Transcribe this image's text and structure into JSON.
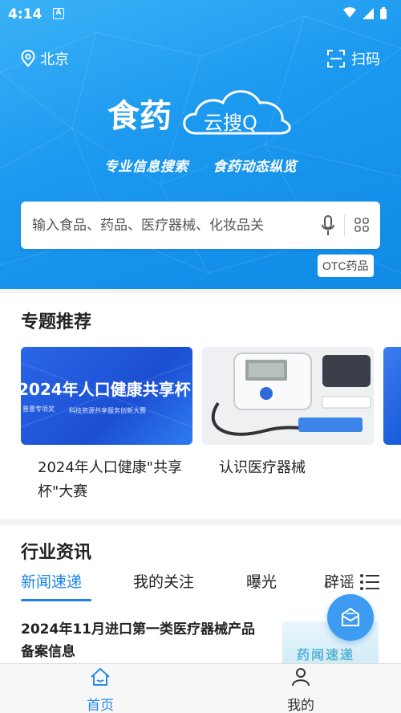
{
  "status_bar": {
    "time": "4:14",
    "a_icon": "A"
  },
  "header": {
    "location": "北京",
    "scan_label": "扫码",
    "logo": "食药云搜Q",
    "slogan_left": "专业信息搜索",
    "slogan_right": "食药动态纵览"
  },
  "search": {
    "placeholder": "输入食品、药品、医疗器械、化妆品关",
    "otc_label": "OTC药品"
  },
  "topics": {
    "title": "专题推荐",
    "cards": [
      {
        "image_text": "2024年人口健康共享杯",
        "image_sub_left": "普惠专项奖",
        "image_sub": "科技资源共享服务创新大赛",
        "caption": "2024年人口健康\"共享杯\"大赛"
      },
      {
        "image_text": "",
        "caption": "认识医疗器械"
      }
    ]
  },
  "news": {
    "title": "行业资讯",
    "tabs": [
      "新闻速递",
      "我的关注",
      "曝光",
      "辟谣"
    ],
    "active_tab": "新闻速递",
    "article_title": "2024年11月进口第一类医疗器械产品备案信息",
    "thumb_text": "药闻速递"
  },
  "bottom_nav": {
    "items": [
      {
        "label": "首页",
        "icon": "home-icon",
        "active": true
      },
      {
        "label": "我的",
        "icon": "user-icon",
        "active": false
      }
    ]
  },
  "colors": {
    "brand_blue": "#1a84e5",
    "hero_blue": "#1b98ef"
  }
}
